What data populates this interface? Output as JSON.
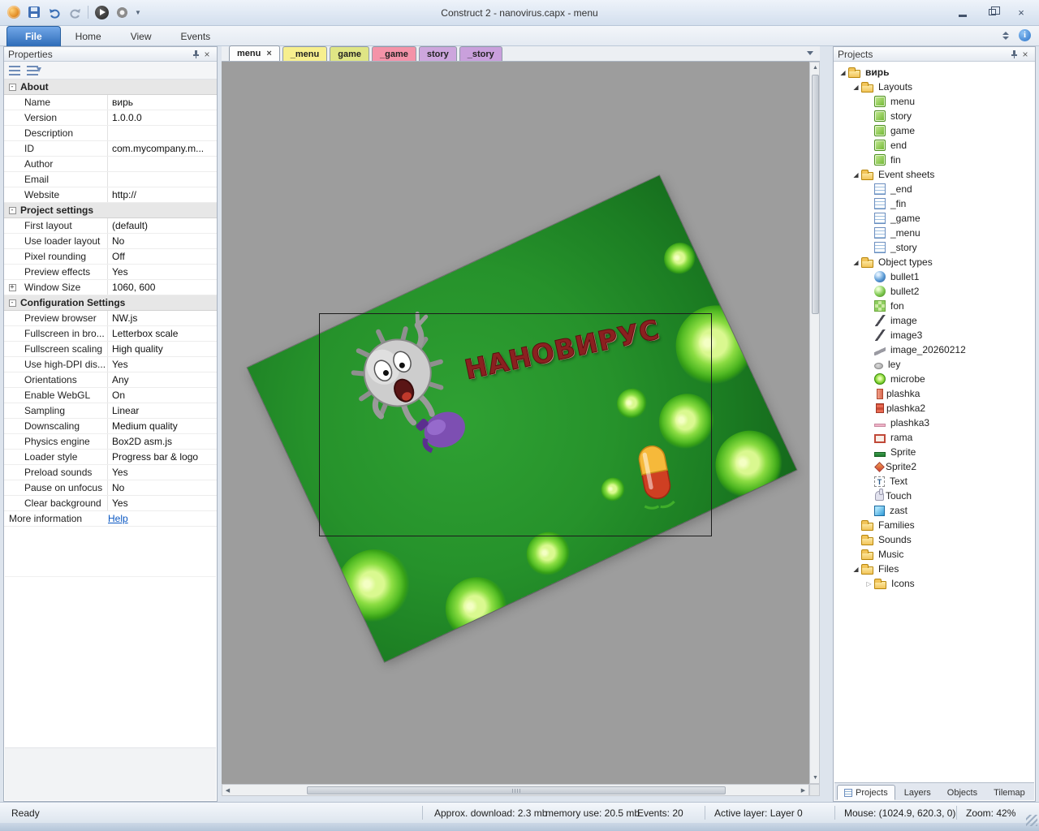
{
  "window": {
    "title": "Construct 2 - nanovirus.capx - menu"
  },
  "ribbon": {
    "tabs": [
      {
        "label": "File",
        "primary": true
      },
      {
        "label": "Home"
      },
      {
        "label": "View"
      },
      {
        "label": "Events"
      }
    ]
  },
  "properties_panel": {
    "title": "Properties",
    "sections": [
      {
        "label": "About",
        "rows": [
          {
            "name": "Name",
            "value": "вирь"
          },
          {
            "name": "Version",
            "value": "1.0.0.0"
          },
          {
            "name": "Description",
            "value": ""
          },
          {
            "name": "ID",
            "value": "com.mycompany.m..."
          },
          {
            "name": "Author",
            "value": ""
          },
          {
            "name": "Email",
            "value": ""
          },
          {
            "name": "Website",
            "value": "http://"
          }
        ]
      },
      {
        "label": "Project settings",
        "rows": [
          {
            "name": "First layout",
            "value": "(default)"
          },
          {
            "name": "Use loader layout",
            "value": "No"
          },
          {
            "name": "Pixel rounding",
            "value": "Off"
          },
          {
            "name": "Preview effects",
            "value": "Yes"
          },
          {
            "name": "Window Size",
            "value": "1060, 600",
            "expandable": true
          }
        ]
      },
      {
        "label": "Configuration Settings",
        "rows": [
          {
            "name": "Preview browser",
            "value": "NW.js"
          },
          {
            "name": "Fullscreen in bro...",
            "value": "Letterbox scale"
          },
          {
            "name": "Fullscreen scaling",
            "value": "High quality"
          },
          {
            "name": "Use high-DPI dis...",
            "value": "Yes"
          },
          {
            "name": "Orientations",
            "value": "Any"
          },
          {
            "name": "Enable WebGL",
            "value": "On"
          },
          {
            "name": "Sampling",
            "value": "Linear"
          },
          {
            "name": "Downscaling",
            "value": "Medium quality"
          },
          {
            "name": "Physics engine",
            "value": "Box2D asm.js"
          },
          {
            "name": "Loader style",
            "value": "Progress bar & logo"
          },
          {
            "name": "Preload sounds",
            "value": "Yes"
          },
          {
            "name": "Pause on unfocus",
            "value": "No"
          },
          {
            "name": "Clear background",
            "value": "Yes"
          }
        ]
      }
    ],
    "more_information_label": "More information",
    "help_link": "Help"
  },
  "editor": {
    "tabs": [
      {
        "label": "menu",
        "active": true,
        "close": true,
        "color": "#fdfdfd"
      },
      {
        "label": "_menu",
        "color": "#f7ef8e"
      },
      {
        "label": "game",
        "color": "#dfe585"
      },
      {
        "label": "_game",
        "color": "#f493a8"
      },
      {
        "label": "story",
        "color": "#cda6dd"
      },
      {
        "label": "_story",
        "color": "#c9a0dc"
      }
    ],
    "canvas": {
      "game_title": "НАНОВИРУС"
    }
  },
  "projects_panel": {
    "title": "Projects",
    "tree": [
      {
        "label": "вирь",
        "depth": 0,
        "icon": "folder",
        "arrow": "open",
        "bold": true
      },
      {
        "label": "Layouts",
        "depth": 1,
        "icon": "folder",
        "arrow": "open"
      },
      {
        "label": "menu",
        "depth": 2,
        "icon": "layout"
      },
      {
        "label": "story",
        "depth": 2,
        "icon": "layout"
      },
      {
        "label": "game",
        "depth": 2,
        "icon": "layout"
      },
      {
        "label": "end",
        "depth": 2,
        "icon": "layout"
      },
      {
        "label": "fin",
        "depth": 2,
        "icon": "layout"
      },
      {
        "label": "Event sheets",
        "depth": 1,
        "icon": "folder",
        "arrow": "open"
      },
      {
        "label": "_end",
        "depth": 2,
        "icon": "sheet"
      },
      {
        "label": "_fin",
        "depth": 2,
        "icon": "sheet"
      },
      {
        "label": "_game",
        "depth": 2,
        "icon": "sheet"
      },
      {
        "label": "_menu",
        "depth": 2,
        "icon": "sheet"
      },
      {
        "label": "_story",
        "depth": 2,
        "icon": "sheet"
      },
      {
        "label": "Object types",
        "depth": 1,
        "icon": "folder",
        "arrow": "open"
      },
      {
        "label": "bullet1",
        "depth": 2,
        "icon": "ball-blue"
      },
      {
        "label": "bullet2",
        "depth": 2,
        "icon": "ball-green"
      },
      {
        "label": "fon",
        "depth": 2,
        "icon": "tile-green"
      },
      {
        "label": "image",
        "depth": 2,
        "icon": "line-dark"
      },
      {
        "label": "image3",
        "depth": 2,
        "icon": "line-dark"
      },
      {
        "label": "image_20260212",
        "depth": 2,
        "icon": "shape-gray"
      },
      {
        "label": "ley",
        "depth": 2,
        "icon": "blob-gray"
      },
      {
        "label": "microbe",
        "depth": 2,
        "icon": "microbe"
      },
      {
        "label": "plashka",
        "depth": 2,
        "icon": "bar-salmon"
      },
      {
        "label": "plashka2",
        "depth": 2,
        "icon": "bar-red"
      },
      {
        "label": "plashka3",
        "depth": 2,
        "icon": "line-pink"
      },
      {
        "label": "rama",
        "depth": 2,
        "icon": "frame-red"
      },
      {
        "label": "Sprite",
        "depth": 2,
        "icon": "bar-darkgreen"
      },
      {
        "label": "Sprite2",
        "depth": 2,
        "icon": "shape-red"
      },
      {
        "label": "Text",
        "depth": 2,
        "icon": "text"
      },
      {
        "label": "Touch",
        "depth": 2,
        "icon": "touch"
      },
      {
        "label": "zast",
        "depth": 2,
        "icon": "tile-cyan"
      },
      {
        "label": "Families",
        "depth": 1,
        "icon": "folder"
      },
      {
        "label": "Sounds",
        "depth": 1,
        "icon": "folder"
      },
      {
        "label": "Music",
        "depth": 1,
        "icon": "folder"
      },
      {
        "label": "Files",
        "depth": 1,
        "icon": "folder",
        "arrow": "open"
      },
      {
        "label": "Icons",
        "depth": 2,
        "icon": "folder",
        "arrow": "closed"
      }
    ],
    "bottom_tabs": [
      {
        "label": "Projects",
        "active": true
      },
      {
        "label": "Layers"
      },
      {
        "label": "Objects"
      },
      {
        "label": "Tilemap"
      }
    ]
  },
  "statusbar": {
    "ready": "Ready",
    "download": "Approx. download: 2.3 mb",
    "memory": "memory use: 20.5 mb",
    "events": "Events: 20",
    "active_layer": "Active layer: Layer 0",
    "mouse": "Mouse: (1024.9, 620.3, 0)",
    "zoom": "Zoom: 42%"
  }
}
